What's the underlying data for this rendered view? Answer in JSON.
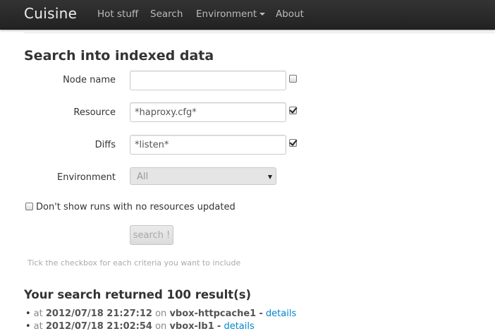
{
  "navbar": {
    "brand": "Cuisine",
    "items": [
      {
        "label": "Hot stuff"
      },
      {
        "label": "Search"
      },
      {
        "label": "Environment"
      },
      {
        "label": "About"
      }
    ]
  },
  "form": {
    "title": "Search into indexed data",
    "node_name": {
      "label": "Node name",
      "value": "",
      "checked": false
    },
    "resource": {
      "label": "Resource",
      "value": "*haproxy.cfg*",
      "checked": true
    },
    "diffs": {
      "label": "Diffs",
      "value": "*listen*",
      "checked": true
    },
    "environment": {
      "label": "Environment",
      "selected": "All"
    },
    "no_resources": {
      "label": "Don't show runs with no resources updated",
      "checked": false
    },
    "submit_label": "search !",
    "help_text": "Tick the checkbox for each criteria you want to include"
  },
  "results": {
    "title": "Your search returned 100 result(s)",
    "rows": [
      {
        "at": "at",
        "date": "2012/07/18 21:27:12",
        "on": "on",
        "node": "vbox-httpcache1",
        "sep": "-",
        "link": "details"
      },
      {
        "at": "at",
        "date": "2012/07/18 21:02:54",
        "on": "on",
        "node": "vbox-lb1",
        "sep": "-",
        "link": "details"
      }
    ]
  },
  "colors": {
    "navbar": "#222222",
    "link": "#0088cc",
    "text": "#333333"
  }
}
